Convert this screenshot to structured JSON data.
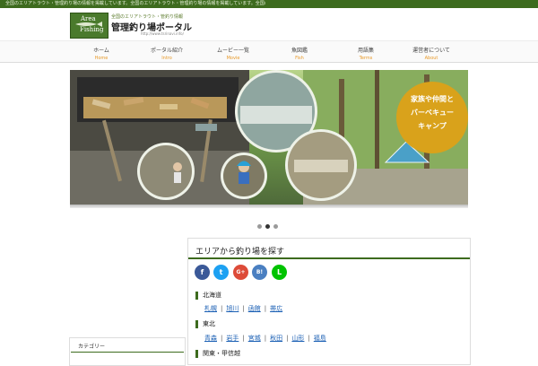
{
  "topbar": {
    "text": "全国のエリアトラウト・管理釣り場の情報を掲載しています。全国のエリアトラウト・管理釣り場の情報を掲載しています。全国のエリアトラウト・管理釣り場の情報を掲載しています。"
  },
  "header": {
    "logo_line1": "Area",
    "logo_line2": "Fishing",
    "tagline": "全国のエリアトラウト・管釣り情報",
    "title": "管理釣り場ポータル",
    "url": "http://www.tsrinavi.info/"
  },
  "nav": [
    {
      "jp": "ホーム",
      "en": "Home"
    },
    {
      "jp": "ポータル紹介",
      "en": "Intro"
    },
    {
      "jp": "ムービー一覧",
      "en": "Movie"
    },
    {
      "jp": "魚図鑑",
      "en": "Fish"
    },
    {
      "jp": "用語集",
      "en": "Terms"
    },
    {
      "jp": "運営者について",
      "en": "About"
    }
  ],
  "slider": {
    "badge_line1": "家族や仲間と",
    "badge_line2": "バーベキュー",
    "badge_line3": "キャンプ",
    "colors": {
      "badge": "#d9a21b",
      "tent": "#4aa0c8"
    }
  },
  "sidebar": {
    "widget_title": "カテゴリー"
  },
  "main": {
    "title": "エリアから釣り場を探す",
    "share": [
      {
        "icon": "facebook-icon",
        "glyph": "f",
        "color": "#3b5998"
      },
      {
        "icon": "twitter-icon",
        "glyph": "t",
        "color": "#1da1f2"
      },
      {
        "icon": "googleplus-icon",
        "glyph": "G+",
        "color": "#dd4b39"
      },
      {
        "icon": "hatena-icon",
        "glyph": "B!",
        "color": "#4a7fc1"
      },
      {
        "icon": "line-icon",
        "glyph": "L",
        "color": "#00c300"
      }
    ],
    "sections": [
      {
        "head": "北海道",
        "links": [
          "札幌",
          "旭川",
          "函館",
          "帯広"
        ]
      },
      {
        "head": "東北",
        "links": [
          "青森",
          "岩手",
          "宮城",
          "秋田",
          "山形",
          "福島"
        ]
      },
      {
        "head": "関東・甲信越",
        "links": []
      }
    ]
  }
}
